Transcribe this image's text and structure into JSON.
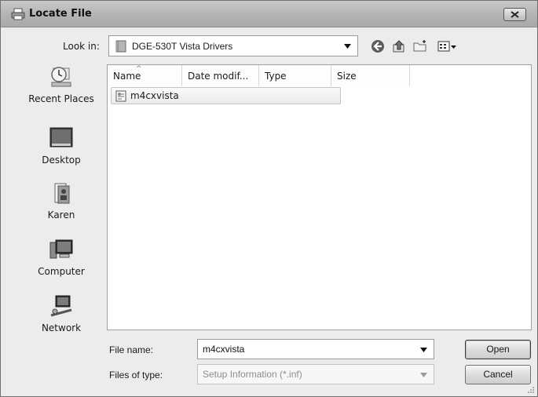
{
  "window": {
    "title": "Locate File",
    "icons": {
      "title": "printer-icon",
      "close": "close-x-icon"
    }
  },
  "toolbar": {
    "look_in_label": "Look in:",
    "look_in_value": "DGE-530T Vista Drivers",
    "icons": [
      "back-icon",
      "up-folder-icon",
      "new-folder-icon",
      "views-icon"
    ]
  },
  "places": [
    {
      "label": "Recent Places",
      "icon": "recent-places-icon"
    },
    {
      "label": "Desktop",
      "icon": "desktop-icon"
    },
    {
      "label": "Karen",
      "icon": "user-folder-icon"
    },
    {
      "label": "Computer",
      "icon": "computer-icon"
    },
    {
      "label": "Network",
      "icon": "network-icon"
    }
  ],
  "file_list": {
    "columns": [
      "Name",
      "Date modif...",
      "Type",
      "Size"
    ],
    "sorted_by": "Name",
    "rows": [
      {
        "name": "m4cxvista",
        "icon": "setup-info-file-icon"
      }
    ]
  },
  "form": {
    "file_name_label": "File name:",
    "file_name_value": "m4cxvista",
    "files_of_type_label": "Files of type:",
    "files_of_type_value": "Setup Information (*.inf)",
    "open_label": "Open",
    "cancel_label": "Cancel"
  }
}
